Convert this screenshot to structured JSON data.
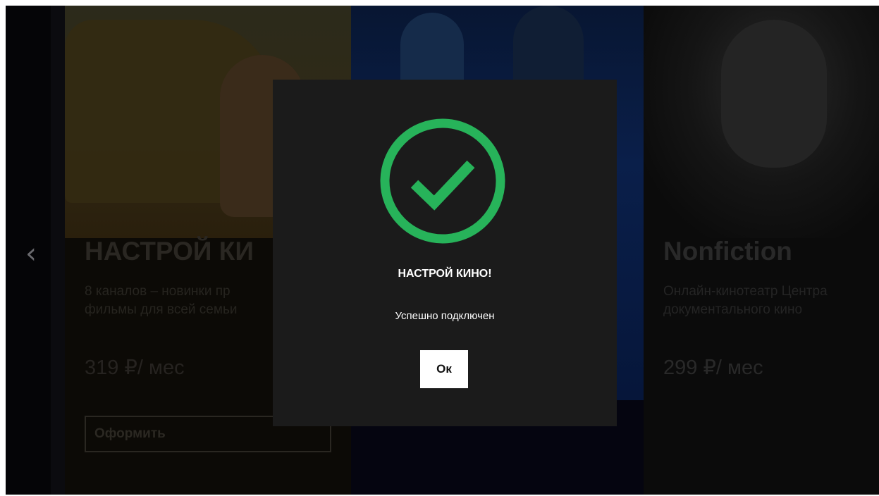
{
  "nav": {
    "prev_arrow": "‹"
  },
  "cards": [
    {
      "title": "НАСТРОЙ КИ",
      "description_lines": [
        "8 каналов – новинки пр",
        "фильмы для всей семьи"
      ],
      "price": "319 ₽/ мес",
      "button_label": "Оформить"
    },
    {
      "title": "Nonfiction",
      "description_lines": [
        "Онлайн-кинотеатр Центра",
        "документального кино"
      ],
      "price": "299 ₽/ мес"
    }
  ],
  "modal": {
    "icon": "check-circle-icon",
    "title": "НАСТРОЙ КИНО!",
    "message": "Успешно подключен",
    "ok_label": "Ок"
  },
  "colors": {
    "background": "#030305",
    "modal_background": "#1b1b1b",
    "success_green": "#27b35a",
    "ok_button": "#ffffff"
  }
}
